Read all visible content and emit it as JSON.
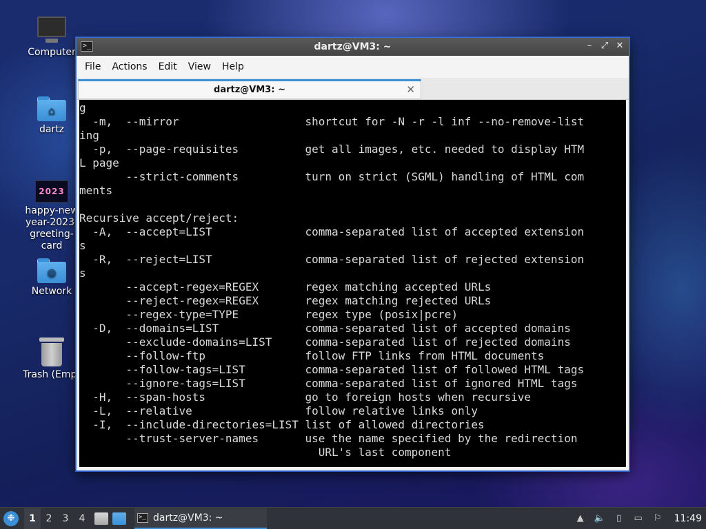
{
  "desktop": {
    "icons": [
      {
        "label": "Computer"
      },
      {
        "label": "dartz"
      },
      {
        "label": "happy-new year-2023- greeting-card",
        "thumb_text": "2023"
      },
      {
        "label": "Network"
      },
      {
        "label": "Trash (Empt"
      }
    ]
  },
  "window": {
    "title": "dartz@VM3: ~",
    "controls": {
      "minimize": "–",
      "maximize": "⤢",
      "close": "✕"
    },
    "menu": [
      "File",
      "Actions",
      "Edit",
      "View",
      "Help"
    ],
    "tab": {
      "label": "dartz@VM3: ~",
      "close": "✕"
    },
    "terminal_lines": [
      "g",
      "  -m,  --mirror                   shortcut for -N -r -l inf --no-remove-list",
      "ing",
      "  -p,  --page-requisites          get all images, etc. needed to display HTM",
      "L page",
      "       --strict-comments          turn on strict (SGML) handling of HTML com",
      "ments",
      "",
      "Recursive accept/reject:",
      "  -A,  --accept=LIST              comma-separated list of accepted extension",
      "s",
      "  -R,  --reject=LIST              comma-separated list of rejected extension",
      "s",
      "       --accept-regex=REGEX       regex matching accepted URLs",
      "       --reject-regex=REGEX       regex matching rejected URLs",
      "       --regex-type=TYPE          regex type (posix|pcre)",
      "  -D,  --domains=LIST             comma-separated list of accepted domains",
      "       --exclude-domains=LIST     comma-separated list of rejected domains",
      "       --follow-ftp               follow FTP links from HTML documents",
      "       --follow-tags=LIST         comma-separated list of followed HTML tags",
      "       --ignore-tags=LIST         comma-separated list of ignored HTML tags",
      "  -H,  --span-hosts               go to foreign hosts when recursive",
      "  -L,  --relative                 follow relative links only",
      "  -I,  --include-directories=LIST list of allowed directories",
      "       --trust-server-names       use the name specified by the redirection",
      "                                    URL's last component"
    ]
  },
  "taskbar": {
    "workspaces": [
      "1",
      "2",
      "3",
      "4"
    ],
    "task_label": "dartz@VM3: ~",
    "clock": "11:49"
  },
  "colors": {
    "accent": "#3b8fd6",
    "terminal_bg": "#000000",
    "terminal_fg": "#d8d8d8"
  }
}
